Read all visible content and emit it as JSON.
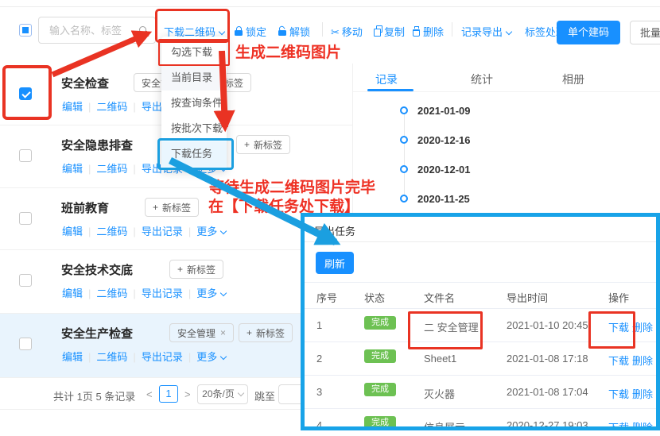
{
  "colors": {
    "primary_blue": "#1890ff",
    "annotation_red": "#ee3124",
    "annotation_blue": "#1b9fe0",
    "badge_green": "#6dc153",
    "row_highlight": "#e9f4fd"
  },
  "toolbar": {
    "search_placeholder": "输入名称、标签",
    "download_qr_label": "下载二维码",
    "lock_label": "锁定",
    "unlock_label": "解锁",
    "move_label": "移动",
    "copy_label": "复制",
    "delete_label": "删除",
    "record_export_label": "记录导出",
    "tag_process_label": "标签处理",
    "single_create_label": "单个建码",
    "batch_create_label": "批量建码",
    "scissors_glyph": "✂"
  },
  "download_menu": {
    "items": [
      "勾选下载",
      "当前目录",
      "按查询条件",
      "按批次下载",
      "下载任务"
    ]
  },
  "annotations": {
    "generate_note": "生成二维码图片",
    "wait_note_line1": "等待生成二维码图片完毕",
    "wait_note_line2": "在【下载任务处下载】"
  },
  "list": {
    "rows": [
      {
        "title": "安全检查",
        "tag": "安全管理",
        "new_tag_label": "新标签"
      },
      {
        "title": "安全隐患排查",
        "new_tag_label": "新标签"
      },
      {
        "title": "班前教育",
        "new_tag_label": "新标签"
      },
      {
        "title": "安全技术交底",
        "new_tag_label": "新标签"
      },
      {
        "title": "安全生产检查",
        "tag": "安全管理",
        "new_tag_label": "新标签"
      }
    ],
    "row_actions": {
      "edit": "编辑",
      "qrcode": "二维码",
      "export_records": "导出记录",
      "more": "更多"
    },
    "pagination": {
      "summary": "共计 1页 5 条记录",
      "prev": "<",
      "next": ">",
      "current_page": "1",
      "page_size": "20条/页",
      "jump_label": "跳至"
    }
  },
  "right_panel": {
    "tabs": [
      {
        "label": "记录"
      },
      {
        "label": "统计"
      },
      {
        "label": "相册"
      }
    ],
    "record_dates": [
      "2021-01-09",
      "2020-12-16",
      "2020-12-01",
      "2020-11-25"
    ]
  },
  "export_panel": {
    "title": "导出任务",
    "refresh_label": "刷新",
    "columns": {
      "no": "序号",
      "status": "状态",
      "filename": "文件名",
      "export_time": "导出时间",
      "actions": "操作"
    },
    "rows": [
      {
        "no": "1",
        "status": "完成",
        "filename": "二 安全管理",
        "time": "2021-01-10 20:45"
      },
      {
        "no": "2",
        "status": "完成",
        "filename": "Sheet1",
        "time": "2021-01-08 17:18"
      },
      {
        "no": "3",
        "status": "完成",
        "filename": "灭火器",
        "time": "2021-01-08 17:04"
      },
      {
        "no": "4",
        "status": "完成",
        "filename": "信息展示",
        "time": "2020-12-27 19:03"
      }
    ],
    "row_actions": {
      "download": "下载",
      "delete": "删除"
    }
  }
}
